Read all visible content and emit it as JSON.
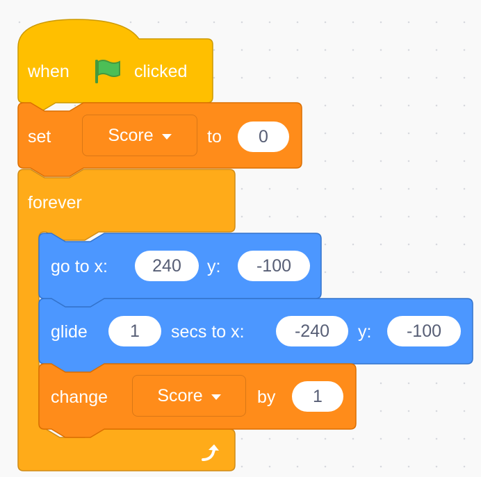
{
  "hat": {
    "when_label": "when",
    "flag_icon": "green-flag-icon",
    "clicked_label": "clicked"
  },
  "set_block": {
    "set_label": "set",
    "variable": "Score",
    "to_label": "to",
    "value": "0"
  },
  "forever_block": {
    "label": "forever",
    "loop_icon": "loop-arrow-icon"
  },
  "goto_block": {
    "label": "go to x:",
    "x": "240",
    "y_label": "y:",
    "y": "-100"
  },
  "glide_block": {
    "label": "glide",
    "secs": "1",
    "secs_label": "secs to x:",
    "x": "-240",
    "y_label": "y:",
    "y": "-100"
  },
  "change_block": {
    "label": "change",
    "variable": "Score",
    "by_label": "by",
    "value": "1"
  },
  "colors": {
    "events": "#ffbf00",
    "variables": "#ff8c1a",
    "control": "#ffab19",
    "motion": "#4c97ff",
    "flag": "#4cbf56"
  }
}
